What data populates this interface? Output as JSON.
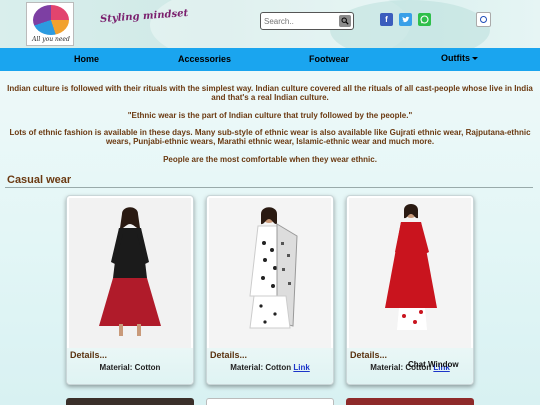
{
  "header": {
    "brand": "Styling mindset",
    "logo_tagline": "All you need",
    "search": {
      "placeholder": "Search.."
    }
  },
  "nav": {
    "items": [
      {
        "label": "Home"
      },
      {
        "label": "Accessories"
      },
      {
        "label": "Footwear"
      },
      {
        "label": "Outfits"
      }
    ]
  },
  "intro": {
    "p1": "Indian culture is followed with their rituals with the simplest way. Indian culture covered all the rituals of all cast-people whose live in India and that's a real Indian culture.",
    "p2": "\"Ethnic wear is the part of Indian culture that truly followed by the people.\"",
    "p3": "Lots of ethnic fashion is available in these days. Many sub-style of ethnic wear is also available like Gujrati ethnic wear, Rajputana-ethnic wears, Punjabi-ethnic wears, Marathi ethnic wear, Islamic-ethnic wear and much more.",
    "p4": "People are the most comfortable when they wear ethnic."
  },
  "section": {
    "title": "Casual wear"
  },
  "cards": [
    {
      "details": "Details...",
      "material": "Material: Cotton",
      "link": ""
    },
    {
      "details": "Details...",
      "material": "Material: Cotton",
      "link": "Link"
    },
    {
      "details": "Details...",
      "material": "Material: Cotton",
      "link": "Link"
    }
  ],
  "chat": {
    "label": "Chat Window"
  },
  "colors": {
    "nav": "#1aa5ef",
    "text_brown": "#6b3a12",
    "link": "#1b35c9"
  }
}
